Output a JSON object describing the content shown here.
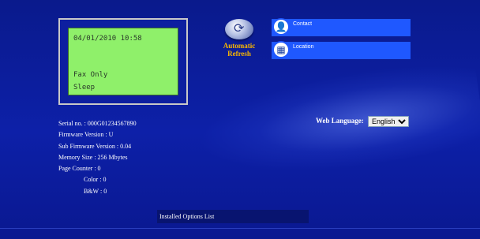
{
  "lcd": {
    "datetime": "04/01/2010 10:58",
    "line2": "Fax Only",
    "line3": "Sleep"
  },
  "refresh": {
    "label": "Automatic Refresh",
    "icon": "refresh-globe-icon"
  },
  "nav": {
    "contact": {
      "label": "Contact",
      "icon": "person-icon"
    },
    "location": {
      "label": "Location",
      "icon": "building-icon"
    }
  },
  "language": {
    "label": "Web Language:",
    "selected": "English",
    "options": [
      "English"
    ]
  },
  "info": {
    "serial": "Serial no. : 000G01234567890",
    "firmware": "Firmware Version : U",
    "sub_firmware": "Sub Firmware Version : 0.04",
    "memory": "Memory Size : 256 Mbytes",
    "page_counter": "Page Counter : 0",
    "color": "Color : 0",
    "bw": "B&W : 0"
  },
  "options_list": {
    "label": "Installed Options List"
  },
  "colors": {
    "background": "#0d20a8",
    "lcd": "#8ff06a",
    "button": "#1f58ff",
    "refresh_text": "#f7b500"
  }
}
